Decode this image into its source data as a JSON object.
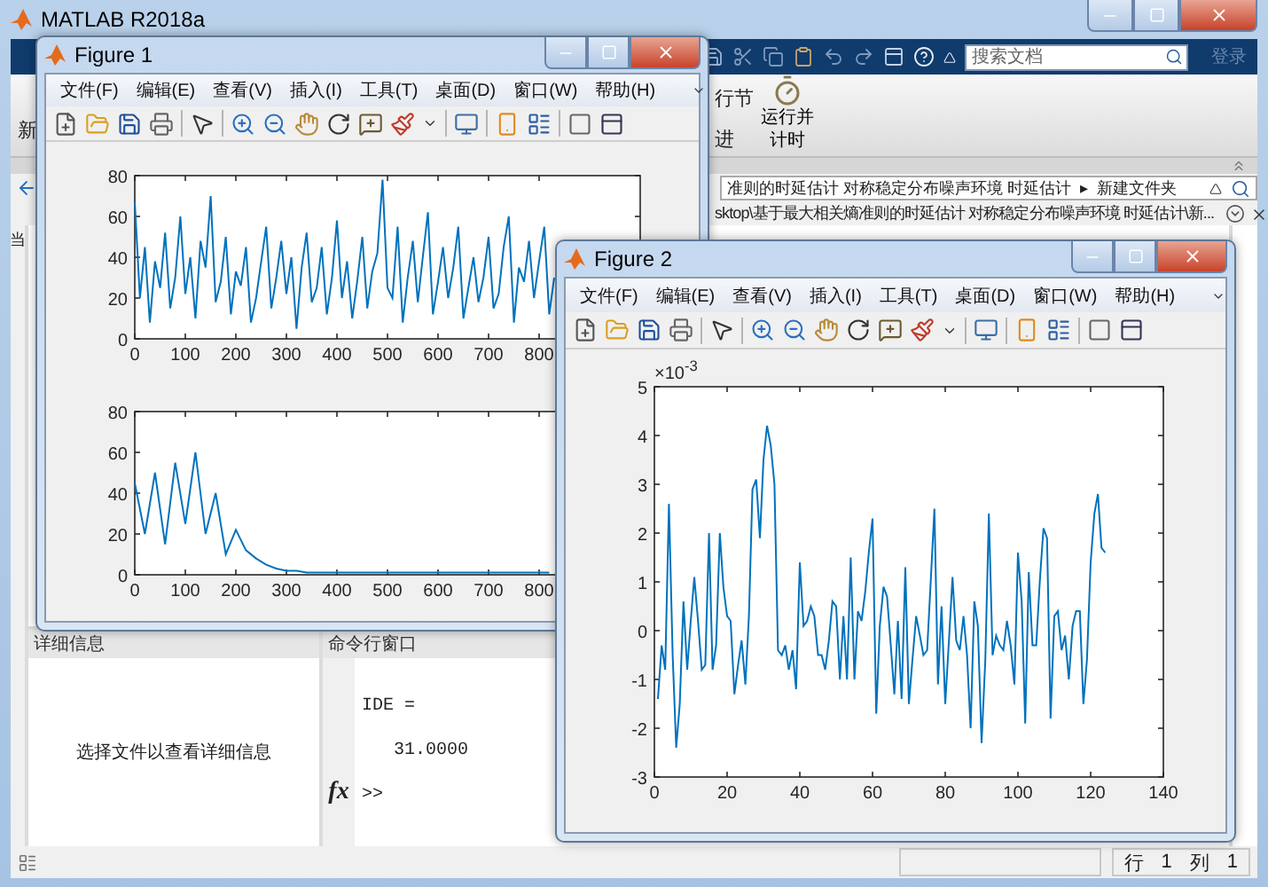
{
  "main_window": {
    "title": "MATLAB R2018a",
    "search": {
      "placeholder": "搜索文档"
    },
    "login": "登录",
    "toolstrip": {
      "left_label": "新",
      "labels": [
        "行节",
        "进"
      ],
      "run_button": "运行并计时"
    },
    "path_bar": {
      "segments": [
        "准则的时延估计 对称稳定分布噪声环境 时延估计",
        "新建文件夹"
      ],
      "separator": "▸"
    },
    "full_path": "sktop\\基于最大相关熵准则的时延估计 对称稳定分布噪声环境 时延估计\\新...",
    "current_folder_label": "当",
    "details_panel": {
      "title": "详细信息",
      "message": "选择文件以查看详细信息"
    },
    "command_window": {
      "title": "命令行窗口",
      "lines": [
        "IDE =",
        "   31.0000"
      ],
      "fx": "fx",
      "prompt": ">>"
    },
    "status_bar": {
      "row_label": "行",
      "row": "1",
      "col_label": "列",
      "col": "1"
    }
  },
  "figures": [
    {
      "title": "Figure 1",
      "menu": [
        "文件(F)",
        "编辑(E)",
        "查看(V)",
        "插入(I)",
        "工具(T)",
        "桌面(D)",
        "窗口(W)",
        "帮助(H)"
      ],
      "charts": [
        {
          "chart_data": {
            "type": "line",
            "xlim": [
              0,
              1000
            ],
            "ylim": [
              0,
              80
            ],
            "xticks": [
              0,
              100,
              200,
              300,
              400,
              500,
              600,
              700,
              800
            ],
            "yticks": [
              0,
              20,
              40,
              60,
              80
            ],
            "x": [
              0,
              10,
              20,
              30,
              40,
              50,
              60,
              70,
              80,
              90,
              100,
              110,
              120,
              130,
              140,
              150,
              160,
              170,
              180,
              190,
              200,
              210,
              220,
              230,
              240,
              250,
              260,
              270,
              280,
              290,
              300,
              310,
              320,
              330,
              340,
              350,
              360,
              370,
              380,
              390,
              400,
              410,
              420,
              430,
              440,
              450,
              460,
              470,
              480,
              490,
              500,
              510,
              520,
              530,
              540,
              550,
              560,
              570,
              580,
              590,
              600,
              610,
              620,
              630,
              640,
              650,
              660,
              670,
              680,
              690,
              700,
              710,
              720,
              730,
              740,
              750,
              760,
              770,
              780,
              790,
              800,
              810,
              820,
              830
            ],
            "series": [
              {
                "color": "#0072bd",
                "values": [
                  67,
                  20,
                  45,
                  8,
                  38,
                  25,
                  52,
                  15,
                  30,
                  60,
                  22,
                  40,
                  10,
                  48,
                  35,
                  70,
                  18,
                  28,
                  50,
                  12,
                  33,
                  26,
                  45,
                  8,
                  20,
                  38,
                  55,
                  15,
                  30,
                  48,
                  22,
                  40,
                  5,
                  35,
                  52,
                  18,
                  25,
                  45,
                  12,
                  30,
                  58,
                  20,
                  38,
                  10,
                  28,
                  50,
                  15,
                  33,
                  42,
                  78,
                  25,
                  20,
                  55,
                  8,
                  30,
                  48,
                  18,
                  40,
                  62,
                  12,
                  28,
                  45,
                  20,
                  35,
                  55,
                  10,
                  25,
                  40,
                  18,
                  30,
                  50,
                  15,
                  22,
                  45,
                  60,
                  8,
                  35,
                  28,
                  48,
                  20,
                  38,
                  55,
                  12,
                  30
                ]
              }
            ]
          }
        },
        {
          "chart_data": {
            "type": "line",
            "xlim": [
              0,
              1000
            ],
            "ylim": [
              0,
              80
            ],
            "xticks": [
              0,
              100,
              200,
              300,
              400,
              500,
              600,
              700,
              800
            ],
            "yticks": [
              0,
              20,
              40,
              60,
              80
            ],
            "x": [
              0,
              20,
              40,
              60,
              80,
              100,
              120,
              140,
              160,
              180,
              200,
              220,
              240,
              260,
              280,
              300,
              320,
              340,
              360,
              380,
              400,
              420,
              440,
              460,
              480,
              500,
              520,
              540,
              560,
              580,
              600,
              620,
              640,
              660,
              680,
              700,
              720,
              740,
              760,
              780,
              800,
              820
            ],
            "series": [
              {
                "color": "#0072bd",
                "values": [
                  45,
                  20,
                  50,
                  15,
                  55,
                  25,
                  60,
                  20,
                  40,
                  10,
                  22,
                  12,
                  8,
                  5,
                  3,
                  2,
                  2,
                  1,
                  1,
                  1,
                  1,
                  1,
                  1,
                  1,
                  1,
                  1,
                  1,
                  1,
                  1,
                  1,
                  1,
                  1,
                  1,
                  1,
                  1,
                  1,
                  1,
                  1,
                  1,
                  1,
                  1,
                  1
                ]
              }
            ]
          }
        }
      ]
    },
    {
      "title": "Figure 2",
      "menu": [
        "文件(F)",
        "编辑(E)",
        "查看(V)",
        "插入(I)",
        "工具(T)",
        "桌面(D)",
        "窗口(W)",
        "帮助(H)"
      ],
      "charts": [
        {
          "chart_data": {
            "type": "line",
            "xlim": [
              0,
              140
            ],
            "ylim": [
              -3,
              5
            ],
            "xticks": [
              0,
              20,
              40,
              60,
              80,
              100,
              120,
              140
            ],
            "yticks": [
              -3,
              -2,
              -1,
              0,
              1,
              2,
              3,
              4,
              5
            ],
            "annotations": [
              {
                "text": "×10$^{-3}$"
              }
            ],
            "x": [
              1,
              2,
              3,
              4,
              5,
              6,
              7,
              8,
              9,
              10,
              11,
              12,
              13,
              14,
              15,
              16,
              17,
              18,
              19,
              20,
              21,
              22,
              23,
              24,
              25,
              26,
              27,
              28,
              29,
              30,
              31,
              32,
              33,
              34,
              35,
              36,
              37,
              38,
              39,
              40,
              41,
              42,
              43,
              44,
              45,
              46,
              47,
              48,
              49,
              50,
              51,
              52,
              53,
              54,
              55,
              56,
              57,
              58,
              59,
              60,
              61,
              62,
              63,
              64,
              65,
              66,
              67,
              68,
              69,
              70,
              71,
              72,
              73,
              74,
              75,
              76,
              77,
              78,
              79,
              80,
              81,
              82,
              83,
              84,
              85,
              86,
              87,
              88,
              89,
              90,
              91,
              92,
              93,
              94,
              95,
              96,
              97,
              98,
              99,
              100,
              101,
              102,
              103,
              104,
              105,
              106,
              107,
              108,
              109,
              110,
              111,
              112,
              113,
              114,
              115,
              116,
              117,
              118,
              119,
              120,
              121,
              122,
              123,
              124
            ],
            "series": [
              {
                "color": "#0072bd",
                "values": [
                  -1.4,
                  -0.3,
                  -0.8,
                  2.6,
                  -0.5,
                  -2.4,
                  -1.5,
                  0.6,
                  -0.8,
                  0.2,
                  1.1,
                  0.2,
                  -0.8,
                  -0.7,
                  2.0,
                  -0.8,
                  -0.3,
                  2.0,
                  0.9,
                  0.3,
                  0.2,
                  -1.3,
                  -0.7,
                  -0.2,
                  -1.1,
                  0.3,
                  2.9,
                  3.1,
                  1.9,
                  3.5,
                  4.2,
                  3.8,
                  3.0,
                  -0.4,
                  -0.5,
                  -0.3,
                  -0.8,
                  -0.4,
                  -1.2,
                  1.4,
                  0.1,
                  0.2,
                  0.5,
                  0.3,
                  -0.5,
                  -0.5,
                  -0.8,
                  -0.2,
                  0.6,
                  0.5,
                  -1.0,
                  0.3,
                  -1.0,
                  1.5,
                  -1.0,
                  0.4,
                  0.2,
                  0.8,
                  1.6,
                  2.3,
                  -1.7,
                  0.1,
                  0.9,
                  0.7,
                  -0.3,
                  -1.3,
                  0.2,
                  -1.4,
                  1.3,
                  -1.5,
                  -0.6,
                  0.3,
                  -0.1,
                  -0.5,
                  -0.4,
                  1.0,
                  2.5,
                  -1.1,
                  0.5,
                  -1.5,
                  -0.2,
                  1.1,
                  -0.2,
                  -0.4,
                  0.3,
                  -0.5,
                  -2.0,
                  0.6,
                  0.1,
                  -2.3,
                  -0.6,
                  2.4,
                  -0.5,
                  -0.1,
                  -0.3,
                  -0.4,
                  0.2,
                  -0.3,
                  -1.1,
                  1.6,
                  0.6,
                  -1.9,
                  1.2,
                  -0.3,
                  -0.3,
                  1.0,
                  2.1,
                  1.9,
                  -1.8,
                  0.3,
                  0.4,
                  -0.4,
                  -0.1,
                  -1.0,
                  0.1,
                  0.4,
                  0.4,
                  -1.5,
                  -0.6,
                  1.4,
                  2.4,
                  2.8,
                  1.7,
                  1.6
                ]
              }
            ]
          }
        }
      ]
    }
  ]
}
